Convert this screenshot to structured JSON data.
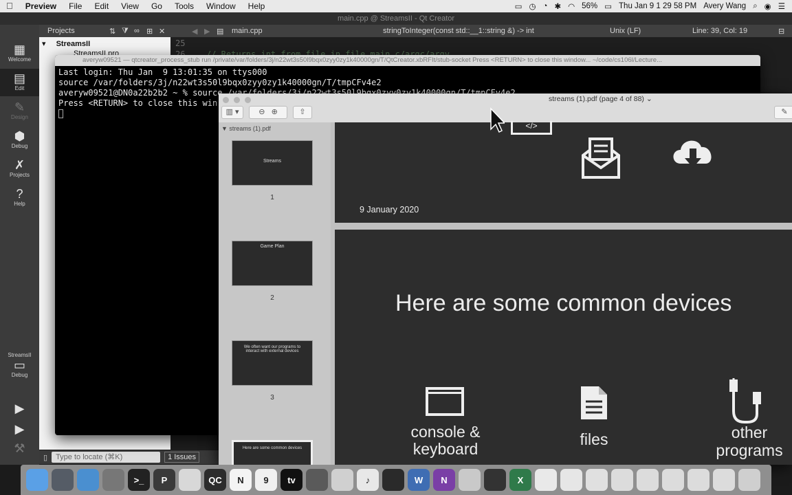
{
  "menubar": {
    "apple": "",
    "app_name": "Preview",
    "menus": [
      "File",
      "Edit",
      "View",
      "Go",
      "Tools",
      "Window",
      "Help"
    ],
    "battery": "56%",
    "datetime": "Thu Jan 9  1 29 58 PM",
    "user": "Avery Wang"
  },
  "qt": {
    "window_title": "main.cpp @ StreamsII - Qt Creator",
    "modes": [
      {
        "label": "Welcome",
        "icon": "grid-icon"
      },
      {
        "label": "Edit",
        "icon": "edit-icon"
      },
      {
        "label": "Design",
        "icon": "pencil-icon"
      },
      {
        "label": "Debug",
        "icon": "bug-icon"
      },
      {
        "label": "Projects",
        "icon": "wrench-icon"
      },
      {
        "label": "Help",
        "icon": "help-icon"
      }
    ],
    "kit": {
      "project": "StreamsII",
      "mode": "Debug"
    },
    "toolbar": {
      "pane_title": "Projects",
      "file": "main.cpp",
      "function": "stringToInteger(const std::__1::string &) -> int",
      "line_endings": "Unix (LF)",
      "position": "Line: 39, Col: 19"
    },
    "project_tree": {
      "root": "StreamsII",
      "child": "StreamsII.pro"
    },
    "line_numbers": [
      "25",
      "26"
    ],
    "code_line": "// Returns int from file in file main.c/argc/argv",
    "locator_placeholder": "Type to locate (⌘K)",
    "issues_label": "1  Issues"
  },
  "terminal": {
    "title": "averyw09521 — qtcreator_process_stub run /private/var/folders/3j/n22wt3s50l9bqx0zyy0zy1k40000gn/T/QtCreator.xbRFIt/stub-socket Press <RETURN> to close this window... ~/code/cs106l/Lecture...",
    "lines": [
      "Last login: Thu Jan  9 13:01:35 on ttys000",
      "source /var/folders/3j/n22wt3s50l9bqx0zyy0zy1k40000gn/T/tmpCFv4e2",
      "averyw09521@DN0a22b2b2 ~ % source /var/folders/3j/n22wt3s50l9bqx0zyy0zy1k40000gn/T/tmpCFv4e2",
      "Press <RETURN> to close this win"
    ]
  },
  "preview": {
    "title": "streams (1).pdf (page 4 of 88) ⌄",
    "sidebar_header": "▼ streams (1).pdf",
    "thumbnails": [
      {
        "number": "1",
        "text": "Streams"
      },
      {
        "number": "2",
        "text": "Game Plan"
      },
      {
        "number": "3",
        "text": "We often want our programs to interact with external devices"
      },
      {
        "number": "4",
        "text": "Here are some common devices"
      }
    ],
    "page3_date": "9 January 2020",
    "page4_heading": "Here are some common devices",
    "devices": [
      {
        "label": "console &\nkeyboard",
        "icon": "console-window-icon"
      },
      {
        "label": "files",
        "icon": "document-icon"
      },
      {
        "label": "other\nprograms",
        "icon": "usb-cables-icon"
      }
    ]
  },
  "dock": {
    "items": [
      {
        "name": "finder-icon",
        "label": "",
        "color": "#5aa0e6"
      },
      {
        "name": "launchpad-icon",
        "label": "",
        "color": "#555c66"
      },
      {
        "name": "safari-icon",
        "label": "",
        "color": "#4a8fd0"
      },
      {
        "name": "system-preferences-icon",
        "label": "",
        "color": "#777"
      },
      {
        "name": "terminal-icon",
        "label": ">_",
        "color": "#222"
      },
      {
        "name": "pdf-app-icon",
        "label": "P",
        "color": "#3a3a3a"
      },
      {
        "name": "chrome-icon",
        "label": "",
        "color": "#d8d8d8"
      },
      {
        "name": "qt-creator-icon",
        "label": "QC",
        "color": "#2c2c2c"
      },
      {
        "name": "notion-icon",
        "label": "N",
        "color": "#f4f4f4"
      },
      {
        "name": "calendar-icon",
        "label": "9",
        "color": "#f0f0f0"
      },
      {
        "name": "apple-tv-icon",
        "label": "tv",
        "color": "#111"
      },
      {
        "name": "siri-icon",
        "label": "",
        "color": "#5a5a5a"
      },
      {
        "name": "photos-icon",
        "label": "",
        "color": "#d0d0d0"
      },
      {
        "name": "music-icon",
        "label": "♪",
        "color": "#e8e8e8"
      },
      {
        "name": "camera-icon",
        "label": "",
        "color": "#2a2a2a"
      },
      {
        "name": "word-icon",
        "label": "W",
        "color": "#3f6db3"
      },
      {
        "name": "onenote-icon",
        "label": "N",
        "color": "#7a3fa6"
      },
      {
        "name": "preview-icon",
        "label": "",
        "color": "#c9c9c9"
      },
      {
        "name": "movie-icon",
        "label": "",
        "color": "#333"
      },
      {
        "name": "excel-icon",
        "label": "X",
        "color": "#2f7a4a"
      },
      {
        "name": "notes-icon",
        "label": "",
        "color": "#e9e9e9"
      },
      {
        "name": "capture-icon",
        "label": "",
        "color": "#e6e6e6"
      },
      {
        "name": "doc-file-icon",
        "label": "",
        "color": "#e0e0e0"
      },
      {
        "name": "screenshot-1-icon",
        "label": "",
        "color": "#dcdcdc"
      },
      {
        "name": "screenshot-2-icon",
        "label": "",
        "color": "#dcdcdc"
      },
      {
        "name": "screenshot-3-icon",
        "label": "",
        "color": "#dcdcdc"
      },
      {
        "name": "screenshot-4-icon",
        "label": "",
        "color": "#dcdcdc"
      },
      {
        "name": "screenshot-5-icon",
        "label": "",
        "color": "#dcdcdc"
      },
      {
        "name": "trash-icon",
        "label": "",
        "color": "#cfcfcf"
      }
    ]
  }
}
